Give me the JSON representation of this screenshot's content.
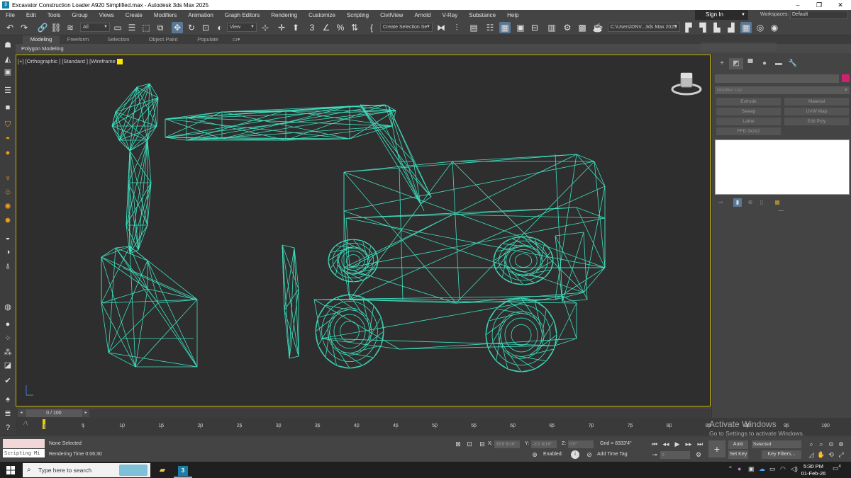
{
  "window": {
    "title": "Excavator Construction Loader A920 Simplified.max - Autodesk 3ds Max 2025",
    "app_icon_text": "3",
    "controls": [
      "–",
      "❐",
      "✕"
    ]
  },
  "menu": [
    "File",
    "Edit",
    "Tools",
    "Group",
    "Views",
    "Create",
    "Modifiers",
    "Animation",
    "Graph Editors",
    "Rendering",
    "Customize",
    "Scripting",
    "CivilView",
    "Arnold",
    "V-Ray",
    "Substance",
    "Help"
  ],
  "account": {
    "sign_in": "Sign In",
    "workspaces_label": "Workspaces:",
    "workspace_value": "Default"
  },
  "toolbar": {
    "selection_filter": "All",
    "ref_coord": "View",
    "named_selection_placeholder": "Create Selection Se",
    "project_path": "C:\\Users\\DNV...3ds Max 2025",
    "icons": [
      "undo-icon",
      "redo-icon",
      "link-icon",
      "unlink-icon",
      "bind-spacewarp-icon",
      "select-object-icon",
      "select-by-name-icon",
      "rect-selection-icon",
      "window-crossing-icon",
      "move-icon",
      "rotate-icon",
      "scale-icon",
      "placement-icon",
      "pivot-icon",
      "keyboard-shortcut-icon",
      "snaps-3d-icon",
      "angle-snap-icon",
      "percent-snap-icon",
      "spinner-snap-icon",
      "edit-named-selection-icon",
      "mirror-icon",
      "align-icon",
      "layer-explorer-icon",
      "scene-explorer-icon",
      "graphite-toggle-icon",
      "curve-editor-icon",
      "schematic-view-icon",
      "material-editor-icon",
      "render-setup-icon",
      "rendered-frame-icon",
      "render-icon",
      "open-file-icon",
      "save-file-icon",
      "import-icon",
      "export-icon",
      "viewport-layout-icon",
      "civilview-icon",
      "arnold-icon"
    ]
  },
  "ribbon": {
    "tabs": [
      "Modeling",
      "Freeform",
      "Selection",
      "Object Paint",
      "Populate"
    ],
    "active_tab": "Modeling",
    "subtitle": "Polygon Modeling"
  },
  "viewport": {
    "label": "[+] [Orthographic ] [Standard ] [Wireframe ]",
    "wire_color": "#3fe0bf",
    "frame_color": "#c8b400",
    "background": "#2e2e2e"
  },
  "command_panel": {
    "tabs": [
      "create-tab",
      "modify-tab",
      "hierarchy-tab",
      "motion-tab",
      "display-tab",
      "utilities-tab"
    ],
    "modifier_list": "Modifier List",
    "buttons": [
      "Extrude",
      "Material",
      "Sweep",
      "UVW Map",
      "Lathe",
      "Edit Poly",
      "FFD 3x2x2"
    ],
    "object_color": "#d0216e"
  },
  "timeline": {
    "frame_display": "0 / 100",
    "ticks": [
      0,
      5,
      10,
      15,
      20,
      25,
      30,
      35,
      40,
      45,
      50,
      55,
      60,
      65,
      70,
      75,
      80,
      85,
      90,
      95,
      100
    ],
    "labels": [
      "5",
      "10",
      "15",
      "20",
      "25",
      "30",
      "35",
      "40",
      "45",
      "50",
      "55",
      "60",
      "65",
      "70",
      "75",
      "80",
      "85",
      "90",
      "95",
      "100"
    ]
  },
  "status": {
    "script_label": "Scripting Mi",
    "selection": "None Selected",
    "render_time": "Rendering Time  0:06:30",
    "x_label": "X:",
    "x_value": "26'9 5/16\"",
    "y_label": "Y:",
    "y_value": "-3'2 6/16\"",
    "z_label": "Z:",
    "z_value": "0'0\"",
    "grid": "Grid = 8333'4\"",
    "enabled": "Enabled:",
    "add_time_tag": "Add Time Tag",
    "auto_key": "Auto Key",
    "selected": "Selected",
    "set_key": "Set Key",
    "key_filters": "Key Filters...",
    "frame_field": "0"
  },
  "watermark": {
    "line1": "Activate Windows",
    "line2": "Go to Settings to activate Windows."
  },
  "taskbar": {
    "search_placeholder": "Type here to search",
    "time": "5:30 PM",
    "date": "01-Feb-26",
    "notification_count": "4"
  }
}
